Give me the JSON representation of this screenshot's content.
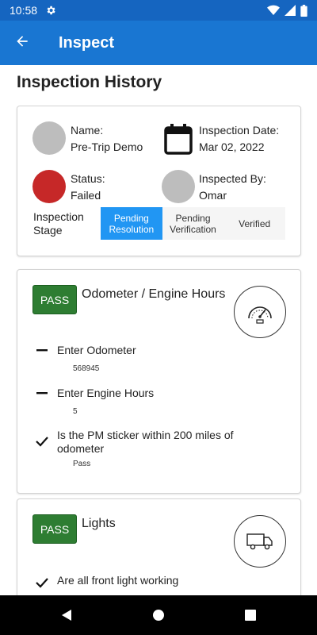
{
  "status_bar": {
    "time": "10:58"
  },
  "app_bar": {
    "title": "Inspect"
  },
  "page": {
    "title": "Inspection History"
  },
  "summary": {
    "name_label": "Name:",
    "name_value": "Pre-Trip Demo",
    "date_label": "Inspection Date:",
    "date_value": "Mar 02, 2022",
    "status_label": "Status:",
    "status_value": "Failed",
    "status_color": "#c62828",
    "inspected_by_label": "Inspected By:",
    "inspected_by_value": "Omar",
    "stage_label": "Inspection Stage",
    "stages": [
      "Pending Resolution",
      "Pending Verification",
      "Verified"
    ],
    "active_stage": "Pending Resolution"
  },
  "checks": [
    {
      "badge": "PASS",
      "title": "Odometer / Engine Hours",
      "icon": "speedometer-icon",
      "items": [
        {
          "mark": "dash",
          "question": "Enter Odometer",
          "answer": "568945"
        },
        {
          "mark": "dash",
          "question": "Enter Engine Hours",
          "answer": "5"
        },
        {
          "mark": "check",
          "question": "Is the PM sticker within 200 miles of odometer",
          "answer": "Pass"
        }
      ]
    },
    {
      "badge": "PASS",
      "title": "Lights",
      "icon": "truck-icon",
      "items": [
        {
          "mark": "check",
          "question": "Are all front light working",
          "answer": ""
        }
      ]
    }
  ],
  "colors": {
    "app_bar": "#1976d2",
    "status_bar": "#1565c0",
    "pass_badge": "#2e7d32",
    "active_stage": "#2196f3"
  }
}
